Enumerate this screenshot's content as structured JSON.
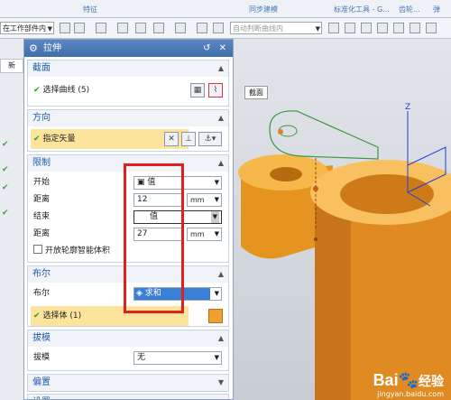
{
  "ribbon": {
    "groups": [
      "特征",
      "同步建模",
      "标准化工具 - G...",
      "齿轮...",
      "弹"
    ]
  },
  "toolbar2": {
    "scope_value": "在工作部件内",
    "snap_value": "自动判断曲线内"
  },
  "left_strip": {
    "tab_label": "新"
  },
  "dialog": {
    "title": "拉伸",
    "title_buttons": "↺ ✕",
    "sections": {
      "section": {
        "header": "截面",
        "select_curve_label": "选择曲线 (5)"
      },
      "direction": {
        "header": "方向",
        "specify_vector_label": "指定矢量"
      },
      "limits": {
        "header": "限制",
        "start_label": "开始",
        "start_value": "值",
        "start_distance_label": "距离",
        "start_distance_value": "12",
        "start_unit": "mm",
        "end_label": "结束",
        "end_value": "值",
        "end_distance_label": "距离",
        "end_distance_value": "27",
        "end_unit": "mm",
        "open_profile_label": "开放轮廓智能体积"
      },
      "boolean": {
        "header": "布尔",
        "boolean_label": "布尔",
        "boolean_value": "求和",
        "select_body_label": "选择体 (1)"
      },
      "draft": {
        "header": "拔模",
        "draft_label": "拔模",
        "draft_value": "无"
      },
      "offset": {
        "header": "偏置"
      },
      "settings": {
        "header": "设置"
      }
    }
  },
  "viewport": {
    "section_tag": "截面",
    "axis_label": "Z"
  },
  "watermark": {
    "brand": "Bai",
    "brand2": "经验",
    "url": "jingyan.baidu.com"
  },
  "colors": {
    "title_bar": "#4a7bb7",
    "section_header": "#1f5fae",
    "highlight": "#fde49c",
    "red_annotation": "#e0201c",
    "model_orange": "#f0a030",
    "curve_green": "#3a9a3a"
  }
}
